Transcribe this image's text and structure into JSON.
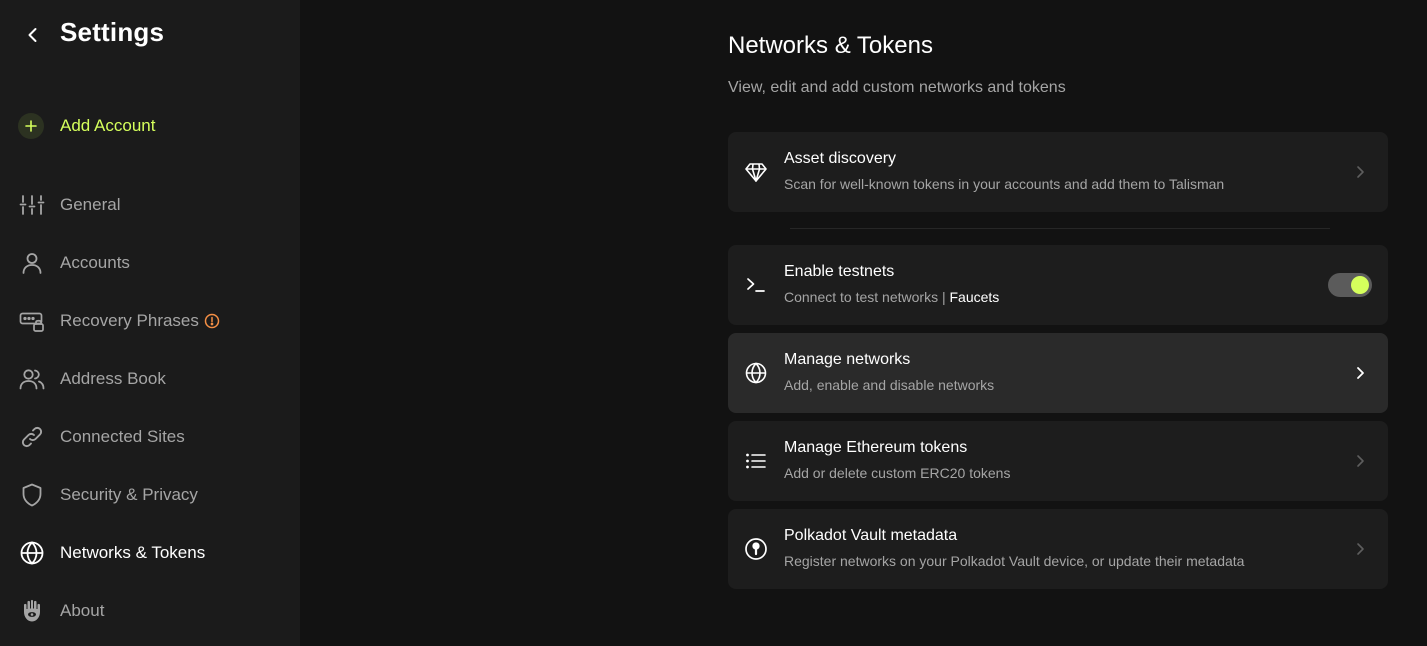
{
  "sidebar": {
    "title": "Settings",
    "back_icon": "chevron-left-icon",
    "add_account": {
      "label": "Add Account",
      "icon": "plus-icon",
      "color": "#d5ff5c"
    },
    "items": [
      {
        "label": "General",
        "icon": "sliders-icon"
      },
      {
        "label": "Accounts",
        "icon": "user-icon"
      },
      {
        "label": "Recovery Phrases",
        "icon": "key-lock-icon",
        "warning": true
      },
      {
        "label": "Address Book",
        "icon": "users-icon"
      },
      {
        "label": "Connected Sites",
        "icon": "link-icon"
      },
      {
        "label": "Security & Privacy",
        "icon": "shield-icon"
      },
      {
        "label": "Networks & Tokens",
        "icon": "globe-icon",
        "active": true
      },
      {
        "label": "About",
        "icon": "hamsa-hand-icon"
      }
    ]
  },
  "main": {
    "title": "Networks & Tokens",
    "subtitle": "View, edit and add custom networks and tokens",
    "cards": {
      "asset_discovery": {
        "title": "Asset discovery",
        "description": "Scan for well-known tokens in your accounts and add them to Talisman",
        "icon": "diamond-icon"
      },
      "enable_testnets": {
        "title": "Enable testnets",
        "description": "Connect to test networks",
        "separator": "|",
        "link": "Faucets",
        "icon": "terminal-icon",
        "enabled": true
      },
      "manage_networks": {
        "title": "Manage networks",
        "description": "Add, enable and disable networks",
        "icon": "globe-icon"
      },
      "manage_eth_tokens": {
        "title": "Manage Ethereum tokens",
        "description": "Add or delete custom ERC20 tokens",
        "icon": "list-icon"
      },
      "polkadot_vault": {
        "title": "Polkadot Vault metadata",
        "description": "Register networks on your Polkadot Vault device, or update their metadata",
        "icon": "polkadot-vault-icon"
      }
    }
  },
  "colors": {
    "accent": "#d5ff5c",
    "warning": "#f48f45",
    "sidebar_bg": "#1b1b1b",
    "main_bg": "#121212",
    "card_bg": "#1d1d1d"
  }
}
